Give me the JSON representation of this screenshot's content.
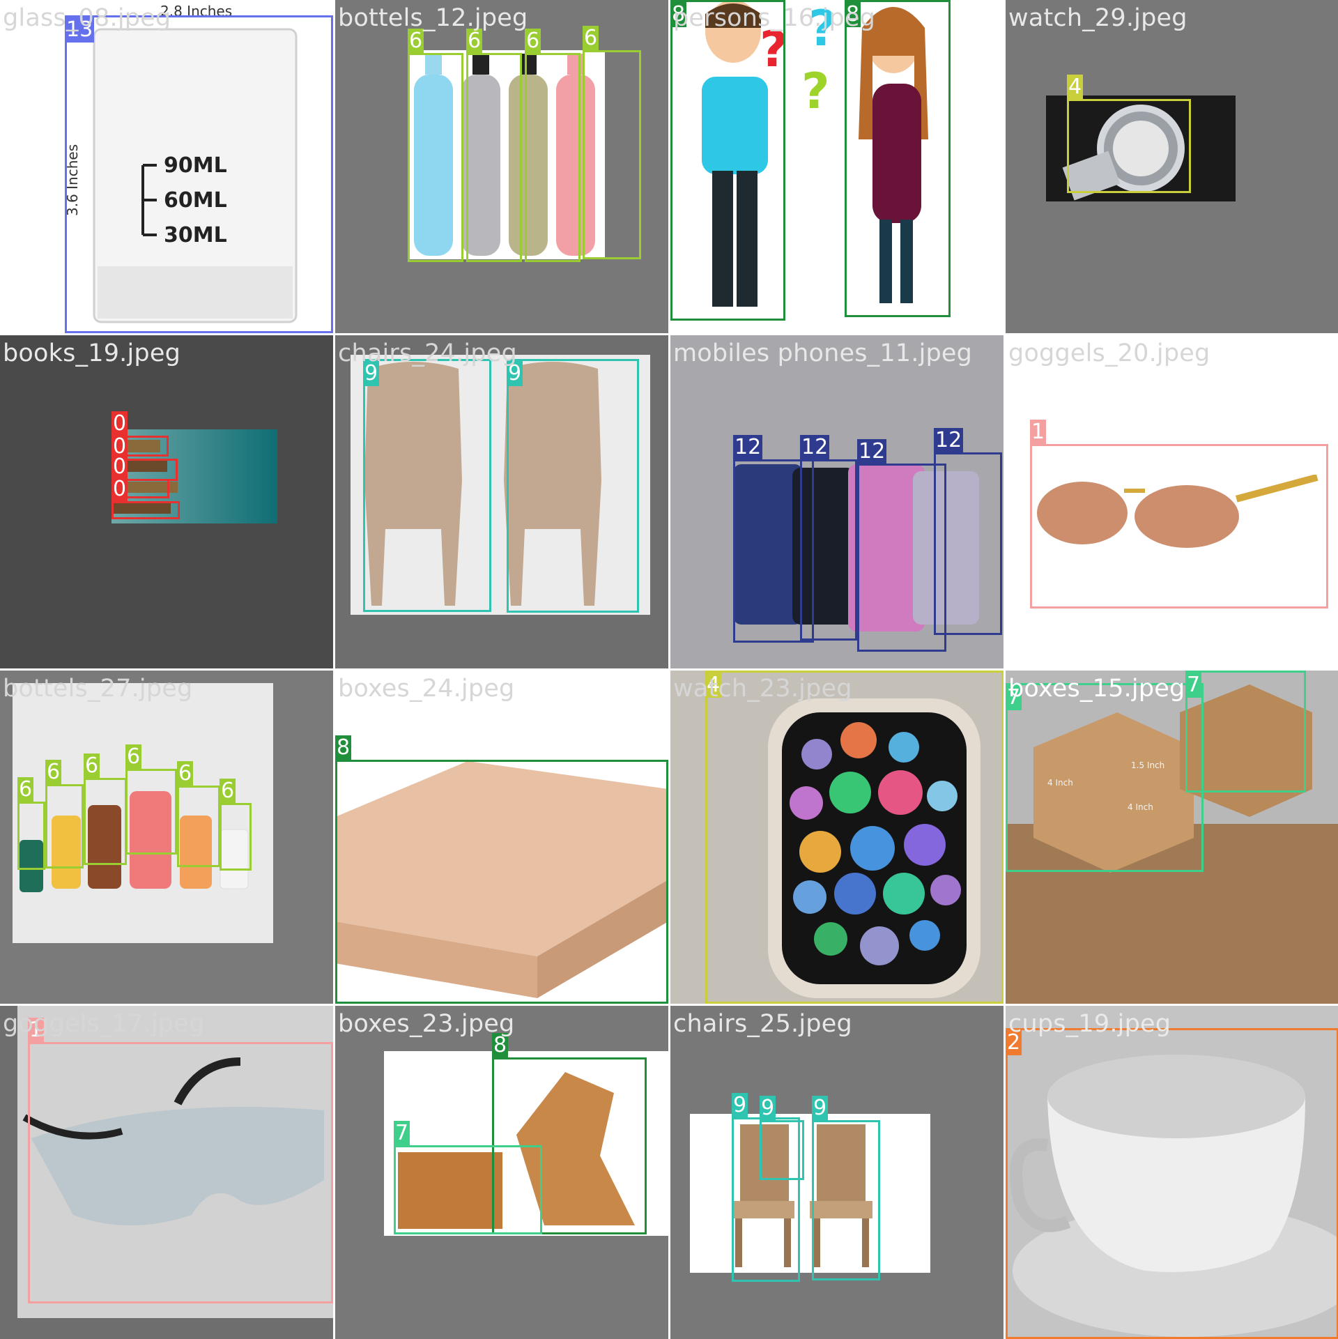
{
  "tiles": [
    {
      "filename": "glass_08.jpeg",
      "image_text": {
        "dim_top": "2.8 Inches",
        "dim_side": "3.6 Inches",
        "m90": "90ML",
        "m60": "60ML",
        "m30": "30ML"
      },
      "detections": [
        {
          "label": "13",
          "color": "#6470ec"
        }
      ]
    },
    {
      "filename": "bottels_12.jpeg",
      "detections": [
        {
          "label": "6"
        },
        {
          "label": "6"
        },
        {
          "label": "6"
        },
        {
          "label": "6"
        }
      ]
    },
    {
      "filename": "persons_16.jpeg",
      "detections": [
        {
          "label": "8"
        },
        {
          "label": "8"
        }
      ]
    },
    {
      "filename": "watch_29.jpeg",
      "detections": [
        {
          "label": "4"
        }
      ]
    },
    {
      "filename": "books_19.jpeg",
      "detections": [
        {
          "label": "0"
        },
        {
          "label": "0"
        },
        {
          "label": "0"
        },
        {
          "label": "0"
        }
      ]
    },
    {
      "filename": "chairs_24.jpeg",
      "detections": [
        {
          "label": "9"
        },
        {
          "label": "9"
        }
      ]
    },
    {
      "filename": "mobiles phones_11.jpeg",
      "detections": [
        {
          "label": "12"
        },
        {
          "label": "12"
        },
        {
          "label": "12"
        },
        {
          "label": "12"
        }
      ]
    },
    {
      "filename": "goggels_20.jpeg",
      "detections": [
        {
          "label": "1"
        }
      ]
    },
    {
      "filename": "bottels_27.jpeg",
      "detections": [
        {
          "label": "6"
        },
        {
          "label": "6"
        },
        {
          "label": "6"
        },
        {
          "label": "6"
        },
        {
          "label": "6"
        },
        {
          "label": "6"
        }
      ]
    },
    {
      "filename": "boxes_24.jpeg",
      "detections": [
        {
          "label": "8"
        }
      ]
    },
    {
      "filename": "watch_23.jpeg",
      "detections": [
        {
          "label": "4"
        }
      ]
    },
    {
      "filename": "boxes_15.jpeg",
      "image_text": {
        "d1": "4 Inch",
        "d2": "4 Inch",
        "d3": "1.5 Inch"
      },
      "detections": [
        {
          "label": "7"
        },
        {
          "label": "7"
        }
      ]
    },
    {
      "filename": "goggels_17.jpeg",
      "detections": [
        {
          "label": "1"
        }
      ]
    },
    {
      "filename": "boxes_23.jpeg",
      "detections": [
        {
          "label": "8"
        },
        {
          "label": "7"
        }
      ]
    },
    {
      "filename": "chairs_25.jpeg",
      "detections": [
        {
          "label": "9"
        },
        {
          "label": "9"
        },
        {
          "label": "9"
        }
      ]
    },
    {
      "filename": "cups_19.jpeg",
      "detections": [
        {
          "label": "2"
        }
      ]
    }
  ],
  "class_colors": {
    "0": "#e8312f",
    "1": "#f5a0a0",
    "2": "#f07a2e",
    "4": "#c9cf3a",
    "6": "#9acd32",
    "7": "#3ed08a",
    "8": "#1f8f3c",
    "9": "#2ec4b0",
    "12": "#2e3b8e",
    "13": "#6470ec"
  },
  "images": {
    "app_icons": [
      "sleep",
      "heart-rate",
      "spo2",
      "music",
      "weather",
      "calendar",
      "lock",
      "clock",
      "moon",
      "camera",
      "settings",
      "steps",
      "apps",
      "sports",
      "phone",
      "voice",
      "timer",
      "chat"
    ]
  }
}
